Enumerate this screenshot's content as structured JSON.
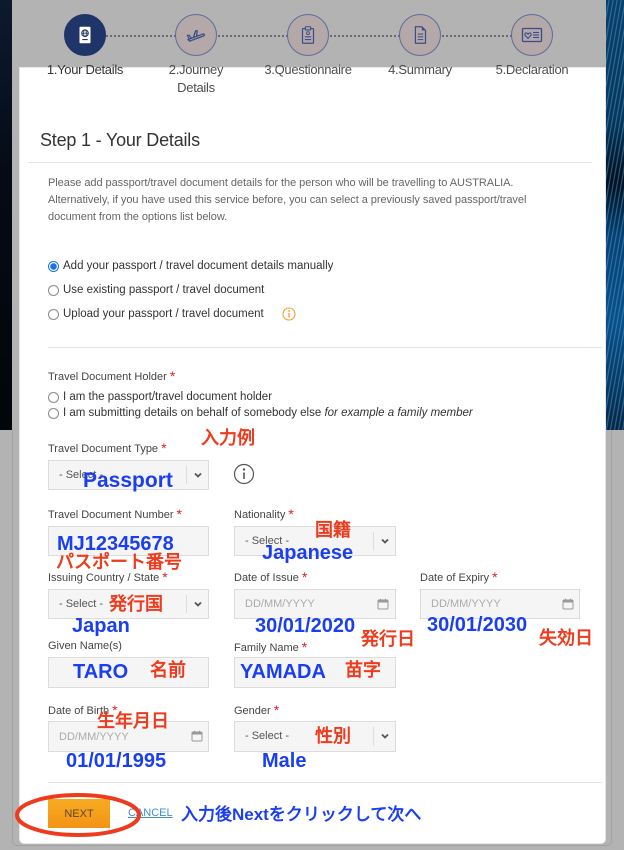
{
  "steps": [
    {
      "label_line1": "1.Your Details",
      "label_line2": "",
      "icon": "passport-icon",
      "state": "active"
    },
    {
      "label_line1": "2.Journey",
      "label_line2": "Details",
      "icon": "airplane-departure-icon",
      "state": "inactive"
    },
    {
      "label_line1": "3.Questionnaire",
      "label_line2": "",
      "icon": "clipboard-icon",
      "state": "inactive"
    },
    {
      "label_line1": "4.Summary",
      "label_line2": "",
      "icon": "document-icon",
      "state": "inactive"
    },
    {
      "label_line1": "5.Declaration",
      "label_line2": "",
      "icon": "declaration-card-icon",
      "state": "inactive"
    }
  ],
  "page": {
    "heading": "Step 1 - Your Details",
    "intro_lines": [
      "Please add passport/travel document details for the person who will be travelling to AUSTRALIA.",
      "Alternatively, if you have used this service before, you can select a previously saved passport/travel",
      "document from the options list below."
    ]
  },
  "source_options": {
    "selected_index": 0,
    "options": [
      {
        "label": "Add your passport / travel document details manually",
        "checked": true
      },
      {
        "label": "Use existing passport / travel document",
        "checked": false
      },
      {
        "label": "Upload your passport / travel document",
        "checked": false,
        "info_icon": "info-icon"
      }
    ]
  },
  "required_mark": "*",
  "holder": {
    "label": "Travel Document Holder",
    "options": [
      {
        "label": "I am the passport/travel document holder",
        "note": "",
        "checked": false
      },
      {
        "label": "I am submitting details on behalf of somebody else",
        "note": "for example a family member",
        "checked": false
      }
    ]
  },
  "fields": {
    "document_type": {
      "label": "Travel Document Type",
      "value": "- Select -",
      "required": true
    },
    "document_number": {
      "label": "Travel Document Number",
      "value": "",
      "required": true
    },
    "nationality": {
      "label": "Nationality",
      "value": "- Select -",
      "required": true
    },
    "issuing_country": {
      "label": "Issuing Country / State",
      "value": "- Select -",
      "required": true
    },
    "date_of_issue": {
      "label": "Date of Issue",
      "placeholder": "DD/MM/YYYY",
      "required": true
    },
    "date_of_expiry": {
      "label": "Date of Expiry",
      "placeholder": "DD/MM/YYYY",
      "required": true
    },
    "given_names": {
      "label": "Given Name(s)",
      "value": "",
      "required": false
    },
    "family_name": {
      "label": "Family Name",
      "value": "",
      "required": true
    },
    "date_of_birth": {
      "label": "Date of Birth",
      "placeholder": "DD/MM/YYYY",
      "required": true
    },
    "gender": {
      "label": "Gender",
      "value": "- Select -",
      "required": true
    }
  },
  "actions": {
    "next": "NEXT",
    "cancel": "CANCEL"
  },
  "annotations": {
    "example_header": "入力例",
    "document_type_value": "Passport",
    "document_number_value": "MJ12345678",
    "document_number_label": "パスポート番号",
    "nationality_label": "国籍",
    "nationality_value": "Japanese",
    "issuing_country_label": "発行国",
    "issuing_country_value": "Japan",
    "date_of_issue_value": "30/01/2020",
    "date_of_issue_label": "発行日",
    "date_of_expiry_value": "30/01/2030",
    "date_of_expiry_label": "失効日",
    "given_name_value": "TARO",
    "given_name_label": "名前",
    "family_name_value": "YAMADA",
    "family_name_label": "苗字",
    "date_of_birth_label": "生年月日",
    "date_of_birth_value": "01/01/1995",
    "gender_label": "性別",
    "gender_value": "Male",
    "next_instruction": "入力後Nextをクリックして次へ"
  },
  "colors": {
    "active_step": "#1f3469",
    "inactive_step": "#b4a8a8",
    "required": "#e0201e",
    "next_button": "#f5a01b",
    "annotation_blue": "#1b3ff0",
    "annotation_red": "#ee3b1d",
    "overlay": "#b3b3b3"
  }
}
